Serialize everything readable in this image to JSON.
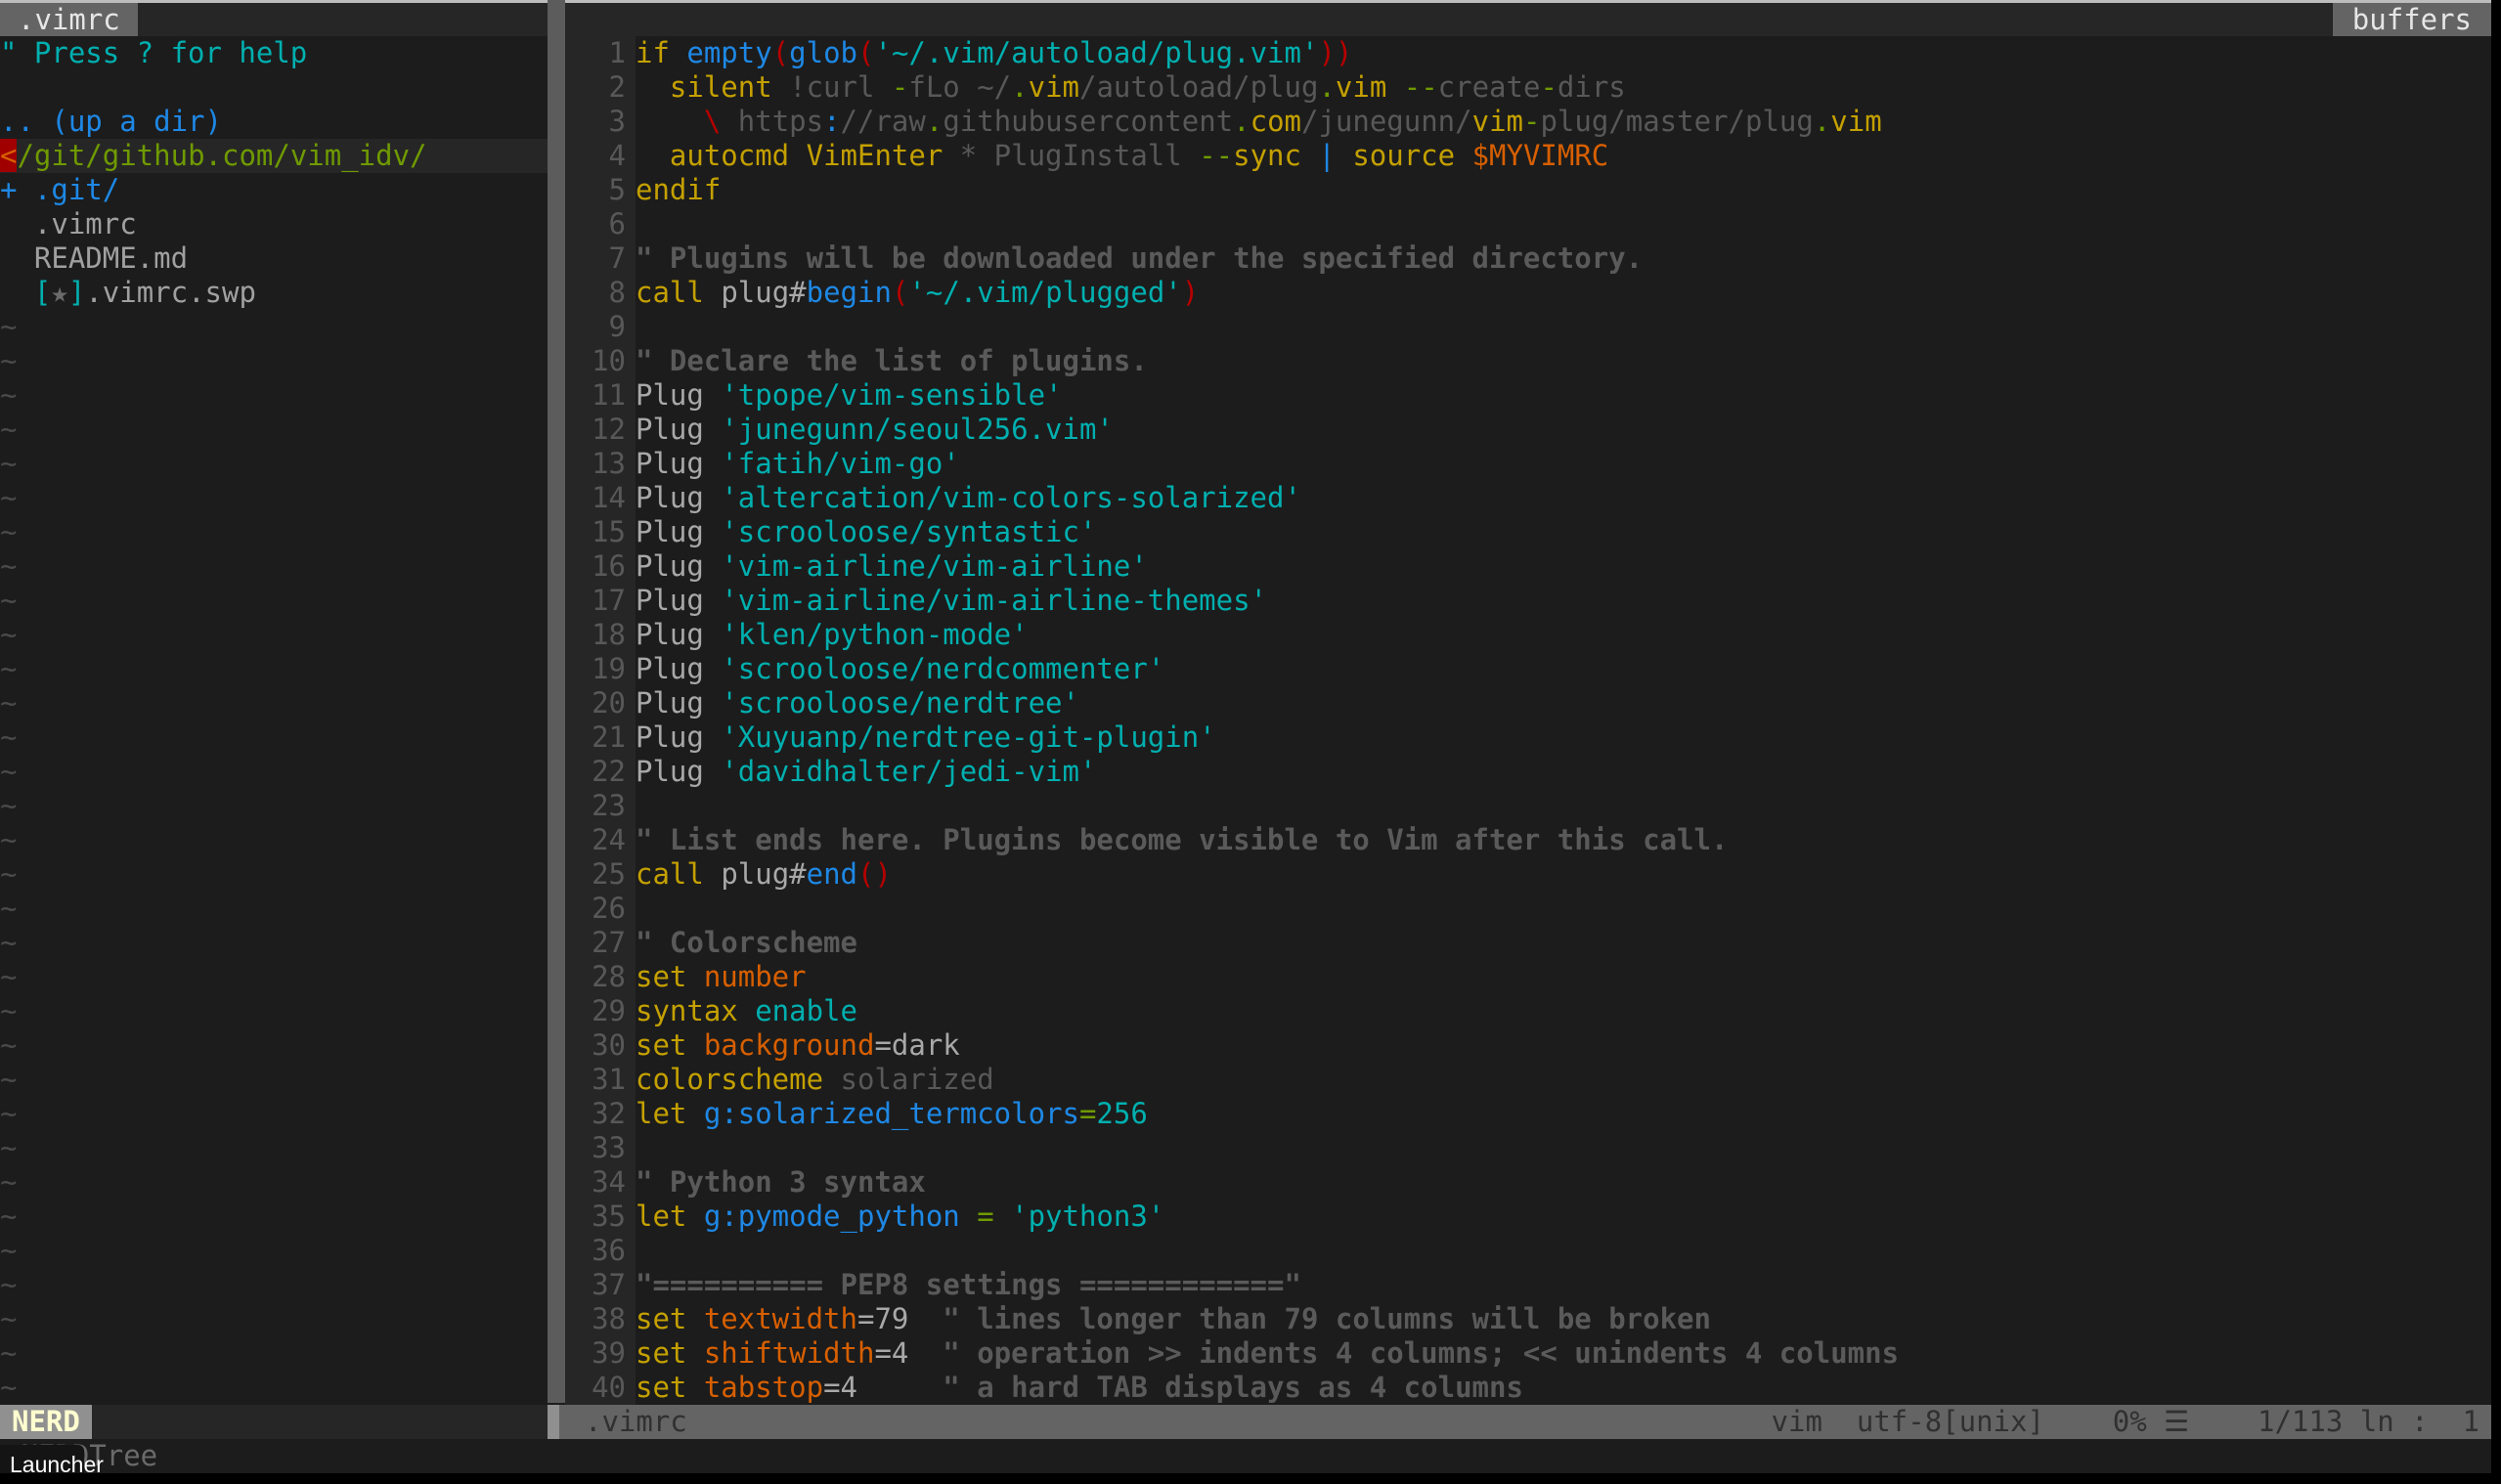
{
  "tabbar": {
    "active_tab": ".vimrc",
    "buffers_label": "buffers"
  },
  "tree": {
    "help": "\" Press ? for help",
    "up_dir": ".. (up a dir)",
    "cwd_marker": "<",
    "cwd": "/git/github.com/vim_idv/",
    "entries": [
      {
        "kind": "dir",
        "prefix": "+ ",
        "name": ".git/"
      },
      {
        "kind": "file",
        "prefix": "  ",
        "name": ".vimrc"
      },
      {
        "kind": "file",
        "prefix": "  ",
        "name": "README.md"
      },
      {
        "kind": "swp",
        "prefix": "  ",
        "open": "[",
        "star": "★",
        "close": "]",
        "name": ".vimrc.swp"
      }
    ],
    "tilde": "~"
  },
  "code": {
    "lines": [
      [
        [
          "kw",
          "if "
        ],
        [
          "fn",
          "empty"
        ],
        [
          "paren",
          "("
        ],
        [
          "fn",
          "glob"
        ],
        [
          "paren",
          "("
        ],
        [
          "str",
          "'~/.vim/autoload/plug.vim'"
        ],
        [
          "paren",
          "))"
        ]
      ],
      [
        [
          "kw",
          "  silent "
        ],
        [
          "dim",
          "!curl "
        ],
        [
          "fold",
          "-"
        ],
        [
          "dim",
          "fLo ~/"
        ],
        [
          "fold",
          "."
        ],
        [
          "kw",
          "vim"
        ],
        [
          "dim",
          "/autoload/plug"
        ],
        [
          "fold",
          "."
        ],
        [
          "kw",
          "vim "
        ],
        [
          "fold",
          "--"
        ],
        [
          "dim",
          "create"
        ],
        [
          "fold",
          "-"
        ],
        [
          "dim",
          "dirs"
        ]
      ],
      [
        [
          "dim",
          "    "
        ],
        [
          "paren",
          "\\"
        ],
        [
          "dim",
          " https"
        ],
        [
          "fn",
          ":"
        ],
        [
          "dim",
          "//raw"
        ],
        [
          "fold",
          "."
        ],
        [
          "dim",
          "githubusercontent"
        ],
        [
          "fold",
          "."
        ],
        [
          "kw",
          "com"
        ],
        [
          "dim",
          "/junegunn/"
        ],
        [
          "kw",
          "vim"
        ],
        [
          "fold",
          "-"
        ],
        [
          "dim",
          "plug/master/plug"
        ],
        [
          "fold",
          "."
        ],
        [
          "kw",
          "vim"
        ]
      ],
      [
        [
          "kw",
          "  autocmd "
        ],
        [
          "kw",
          "VimEnter "
        ],
        [
          "dim",
          "* PlugInstall "
        ],
        [
          "fold",
          "--"
        ],
        [
          "kw",
          "sync "
        ],
        [
          "pipe",
          "| "
        ],
        [
          "kw",
          "source "
        ],
        [
          "env",
          "$MYVIMRC"
        ]
      ],
      [
        [
          "kw",
          "endif"
        ]
      ],
      [],
      [
        [
          "cmt",
          "\" Plugins will be downloaded under the specified directory."
        ]
      ],
      [
        [
          "kw",
          "call "
        ],
        [
          "plain",
          "plug#"
        ],
        [
          "fn",
          "begin"
        ],
        [
          "paren",
          "("
        ],
        [
          "str",
          "'~/.vim/plugged'"
        ],
        [
          "paren",
          ")"
        ]
      ],
      [],
      [
        [
          "cmt",
          "\" Declare the list of plugins."
        ]
      ],
      [
        [
          "plain",
          "Plug "
        ],
        [
          "str",
          "'tpope/vim-sensible'"
        ]
      ],
      [
        [
          "plain",
          "Plug "
        ],
        [
          "str",
          "'junegunn/seoul256.vim'"
        ]
      ],
      [
        [
          "plain",
          "Plug "
        ],
        [
          "str",
          "'fatih/vim-go'"
        ]
      ],
      [
        [
          "plain",
          "Plug "
        ],
        [
          "str",
          "'altercation/vim-colors-solarized'"
        ]
      ],
      [
        [
          "plain",
          "Plug "
        ],
        [
          "str",
          "'scrooloose/syntastic'"
        ]
      ],
      [
        [
          "plain",
          "Plug "
        ],
        [
          "str",
          "'vim-airline/vim-airline'"
        ]
      ],
      [
        [
          "plain",
          "Plug "
        ],
        [
          "str",
          "'vim-airline/vim-airline-themes'"
        ]
      ],
      [
        [
          "plain",
          "Plug "
        ],
        [
          "str",
          "'klen/python-mode'"
        ]
      ],
      [
        [
          "plain",
          "Plug "
        ],
        [
          "str",
          "'scrooloose/nerdcommenter'"
        ]
      ],
      [
        [
          "plain",
          "Plug "
        ],
        [
          "str",
          "'scrooloose/nerdtree'"
        ]
      ],
      [
        [
          "plain",
          "Plug "
        ],
        [
          "str",
          "'Xuyuanp/nerdtree-git-plugin'"
        ]
      ],
      [
        [
          "plain",
          "Plug "
        ],
        [
          "str",
          "'davidhalter/jedi-vim'"
        ]
      ],
      [],
      [
        [
          "cmt",
          "\" List ends here. Plugins become visible to Vim after this call."
        ]
      ],
      [
        [
          "kw",
          "call "
        ],
        [
          "plain",
          "plug#"
        ],
        [
          "fn",
          "end"
        ],
        [
          "paren",
          "()"
        ]
      ],
      [],
      [
        [
          "cmt",
          "\" Colorscheme"
        ]
      ],
      [
        [
          "kw",
          "set "
        ],
        [
          "opt",
          "number"
        ]
      ],
      [
        [
          "kw",
          "syntax "
        ],
        [
          "str",
          "enable"
        ]
      ],
      [
        [
          "kw",
          "set "
        ],
        [
          "opt",
          "background"
        ],
        [
          "plain",
          "=dark"
        ]
      ],
      [
        [
          "kw",
          "colorscheme "
        ],
        [
          "dim2",
          "solarized"
        ]
      ],
      [
        [
          "kw",
          "let "
        ],
        [
          "var",
          "g:solarized_termcolors"
        ],
        [
          "eq",
          "="
        ],
        [
          "num",
          "256"
        ]
      ],
      [],
      [
        [
          "cmt",
          "\" Python 3 syntax"
        ]
      ],
      [
        [
          "kw",
          "let "
        ],
        [
          "var",
          "g:pymode_python "
        ],
        [
          "eq",
          "= "
        ],
        [
          "str",
          "'python3'"
        ]
      ],
      [],
      [
        [
          "cmt",
          "\"========== PEP8 settings ============\""
        ]
      ],
      [
        [
          "kw",
          "set "
        ],
        [
          "opt",
          "textwidth"
        ],
        [
          "plain",
          "=79  "
        ],
        [
          "cmt",
          "\" lines longer than 79 columns will be broken"
        ]
      ],
      [
        [
          "kw",
          "set "
        ],
        [
          "opt",
          "shiftwidth"
        ],
        [
          "plain",
          "=4  "
        ],
        [
          "cmt",
          "\" operation >> indents 4 columns; << unindents 4 columns"
        ]
      ],
      [
        [
          "kw",
          "set "
        ],
        [
          "opt",
          "tabstop"
        ],
        [
          "plain",
          "=4     "
        ],
        [
          "cmt",
          "\" a hard TAB displays as 4 columns"
        ]
      ]
    ]
  },
  "status": {
    "mode": "NERD",
    "filename": ".vimrc",
    "filetype": "vim",
    "encoding": "utf-8[unix]",
    "percent": "0%",
    "percent_icon": "☰",
    "position": "1/113 ln :  1"
  },
  "cmdline": {
    "text": ":NERDTree"
  },
  "launcher": {
    "label": "Launcher"
  }
}
